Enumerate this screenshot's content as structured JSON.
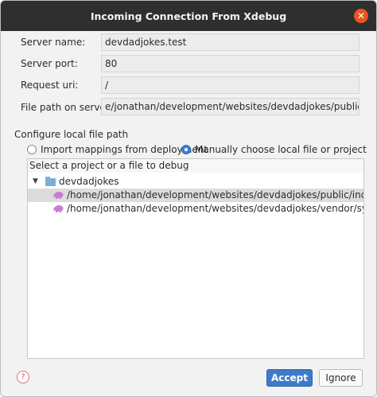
{
  "window": {
    "title": "Incoming Connection From Xdebug",
    "close_icon": "close-icon"
  },
  "fields": {
    "server_name": {
      "label": "Server name:",
      "value": "devdadjokes.test"
    },
    "server_port": {
      "label": "Server port:",
      "value": "80"
    },
    "request_uri": {
      "label": "Request uri:",
      "value": "/"
    },
    "file_path": {
      "label": "File path on server:",
      "value": "e/jonathan/development/websites/devdadjokes/public/index.php"
    }
  },
  "local_path": {
    "section_title": "Configure local file path",
    "options": [
      {
        "label": "Import mappings from deployment",
        "checked": false
      },
      {
        "label": "Manually choose local file or project",
        "checked": true
      }
    ],
    "tree_header": "Select a project or a file to debug",
    "project": {
      "name": "devdadjokes",
      "icon": "folder-icon",
      "expanded": true
    },
    "files": [
      {
        "path": "/home/jonathan/development/websites/devdadjokes/public/index.php",
        "icon": "php-elephant-icon",
        "selected": true
      },
      {
        "path": "/home/jonathan/development/websites/devdadjokes/vendor/symfony/http-c",
        "icon": "php-elephant-icon",
        "selected": false
      }
    ]
  },
  "footer": {
    "help_icon": "help-icon",
    "accept_label": "Accept",
    "ignore_label": "Ignore"
  },
  "colors": {
    "titlebar": "#2f2f2f",
    "close_button": "#e95420",
    "accent": "#3e7ac9",
    "selected_row": "#dcdcdc"
  }
}
